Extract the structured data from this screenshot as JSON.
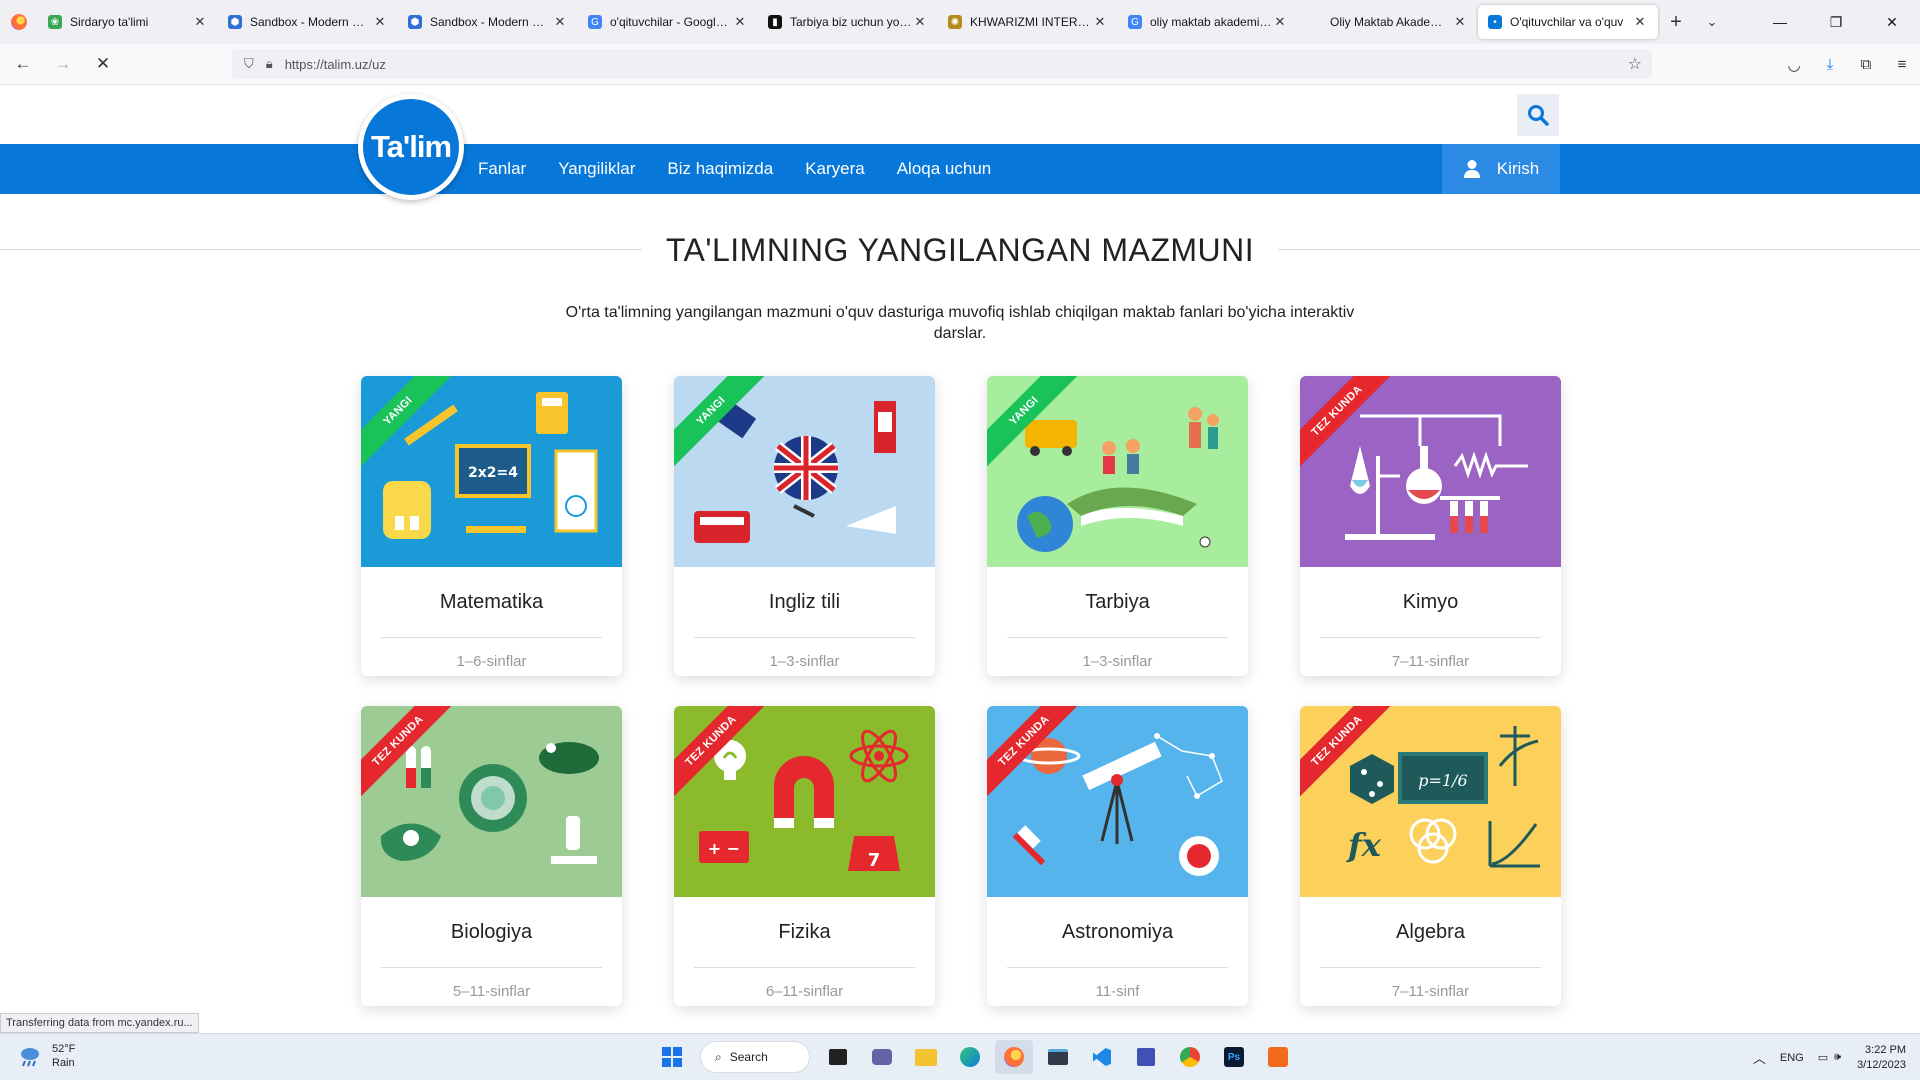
{
  "browser": {
    "tabs": [
      {
        "title": "Sirdaryo ta'limi",
        "fav_color": "#3aa757",
        "fav_glyph": "❀"
      },
      {
        "title": "Sandbox - Modern & M",
        "fav_color": "#2f6fd6",
        "fav_glyph": "⬢"
      },
      {
        "title": "Sandbox - Modern & M",
        "fav_color": "#2f6fd6",
        "fav_glyph": "⬢"
      },
      {
        "title": "o'qituvchilar - Google S",
        "fav_color": "#4285f4",
        "fav_glyph": "G"
      },
      {
        "title": "Tarbiya biz uchun yo ha",
        "fav_color": "#111111",
        "fav_glyph": "▮"
      },
      {
        "title": "KHWARIZMI INTERNAT",
        "fav_color": "#b58a1b",
        "fav_glyph": "✺"
      },
      {
        "title": "oliy maktab akademiya",
        "fav_color": "#4285f4",
        "fav_glyph": "G"
      },
      {
        "title": "Oliy Maktab Akademiyasi",
        "fav_color": "#ffffff",
        "fav_glyph": ""
      },
      {
        "title": "O'qituvchilar va o'quv",
        "fav_color": "#0777d9",
        "fav_glyph": "•"
      }
    ],
    "url": "https://talim.uz/uz"
  },
  "site": {
    "logo_text": "Ta'lim",
    "menu": [
      "Fanlar",
      "Yangiliklar",
      "Biz haqimizda",
      "Karyera",
      "Aloqa uchun"
    ],
    "login_label": "Kirish",
    "section_title": "TA'LIMNING YANGILANGAN MAZMUNI",
    "subtitle": "O'rta ta'limning yangilangan mazmuni o'quv dasturiga muvofiq ishlab chiqilgan maktab fanlari bo'yicha interaktiv darslar.",
    "courses": [
      {
        "name": "Matematika",
        "grade": "1–6-sinflar",
        "badge": "YANGI",
        "badge_type": "new",
        "bg": "#1a9ad6"
      },
      {
        "name": "Ingliz tili",
        "grade": "1–3-sinflar",
        "badge": "YANGI",
        "badge_type": "new",
        "bg": "#bcd9f2"
      },
      {
        "name": "Tarbiya",
        "grade": "1–3-sinflar",
        "badge": "YANGI",
        "badge_type": "new",
        "bg": "#a8ec9d"
      },
      {
        "name": "Kimyo",
        "grade": "7–11-sinflar",
        "badge": "TEZ KUNDA",
        "badge_type": "soon",
        "bg": "#9a63c4"
      },
      {
        "name": "Biologiya",
        "grade": "5–11-sinflar",
        "badge": "TEZ KUNDA",
        "badge_type": "soon",
        "bg": "#9ccc94"
      },
      {
        "name": "Fizika",
        "grade": "6–11-sinflar",
        "badge": "TEZ KUNDA",
        "badge_type": "soon",
        "bg": "#8bbb2c"
      },
      {
        "name": "Astronomiya",
        "grade": "11-sinf",
        "badge": "TEZ KUNDA",
        "badge_type": "soon",
        "bg": "#55b4ec"
      },
      {
        "name": "Algebra",
        "grade": "7–11-sinflar",
        "badge": "TEZ KUNDA",
        "badge_type": "soon",
        "bg": "#fbd15b"
      }
    ]
  },
  "status_bar": "Transferring data from mc.yandex.ru...",
  "taskbar": {
    "weather_temp": "52°F",
    "weather_desc": "Rain",
    "search_label": "Search",
    "lang": "ENG",
    "time": "3:22 PM",
    "date": "3/12/2023"
  }
}
